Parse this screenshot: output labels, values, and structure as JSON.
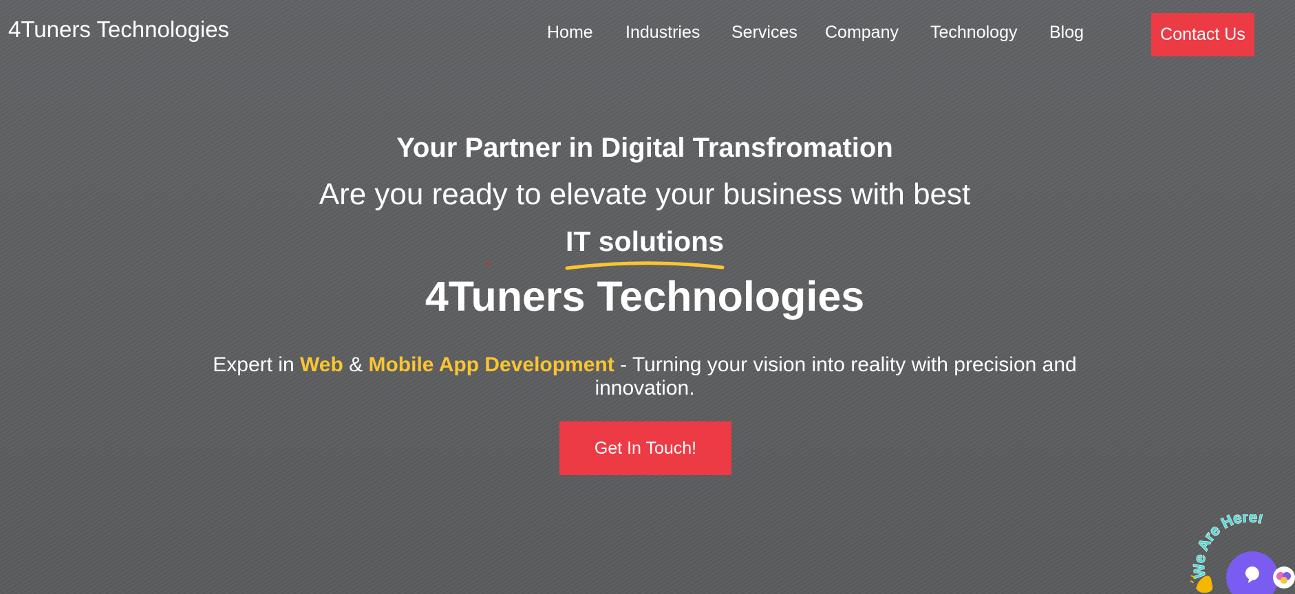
{
  "header": {
    "logo": "4Tuners Technologies",
    "nav": [
      "Home",
      "Industries",
      "Services",
      "Company",
      "Technology",
      "Blog"
    ],
    "contact_label": "Contact Us"
  },
  "hero": {
    "tagline": "Your Partner in Digital Transfromation",
    "question": "Are you ready to elevate your business with best",
    "highlight": "IT solutions",
    "brand": "4Tuners Technologies",
    "description": {
      "prefix": "Expert in ",
      "accent_1": "Web",
      "connector": " & ",
      "accent_2": "Mobile App Development",
      "suffix": " - Turning your vision into reality with precision and innovation."
    },
    "cta_label": "Get In Touch!"
  },
  "chat_widget": {
    "label": "We Are Here!",
    "icons": [
      "waving-hand-icon",
      "chat-bubble-icon",
      "brain-icon"
    ]
  },
  "colors": {
    "accent_red": "#ec3b45",
    "accent_yellow": "#f9c531",
    "background": "#5f6062",
    "chat_purple": "#7b5cf0",
    "chat_teal": "#52dad6"
  }
}
